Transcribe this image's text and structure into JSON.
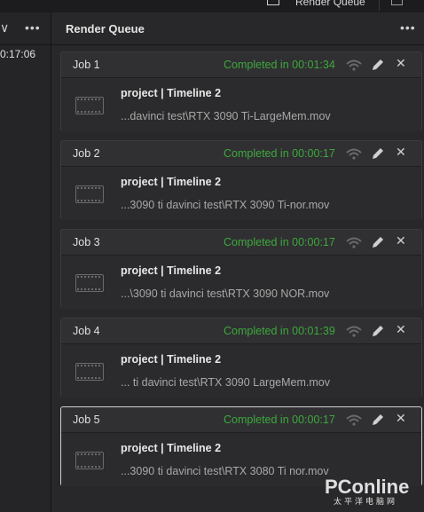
{
  "topbar": {
    "render_queue_label": "Render Queue"
  },
  "left_panel": {
    "timecode": "0:17:06"
  },
  "render_queue": {
    "title": "Render Queue",
    "status_color": "#3da83d",
    "jobs": [
      {
        "name": "Job 1",
        "status": "Completed in 00:01:34",
        "title": "project | Timeline 2",
        "path": "...davinci test\\RTX 3090 Ti-LargeMem.mov"
      },
      {
        "name": "Job 2",
        "status": "Completed in 00:00:17",
        "title": "project | Timeline 2",
        "path": "...3090 ti davinci test\\RTX 3090 Ti-nor.mov"
      },
      {
        "name": "Job 3",
        "status": "Completed in 00:00:17",
        "title": "project | Timeline 2",
        "path": "...\\3090 ti davinci test\\RTX 3090 NOR.mov"
      },
      {
        "name": "Job 4",
        "status": "Completed in 00:01:39",
        "title": "project | Timeline 2",
        "path": "... ti davinci test\\RTX 3090 LargeMem.mov"
      },
      {
        "name": "Job 5",
        "status": "Completed in 00:00:17",
        "title": "project | Timeline 2",
        "path": "...3090 ti davinci test\\RTX 3080 Ti nor.mov"
      }
    ]
  },
  "watermark": {
    "text": "PConline",
    "sub": "太平洋电脑网"
  }
}
